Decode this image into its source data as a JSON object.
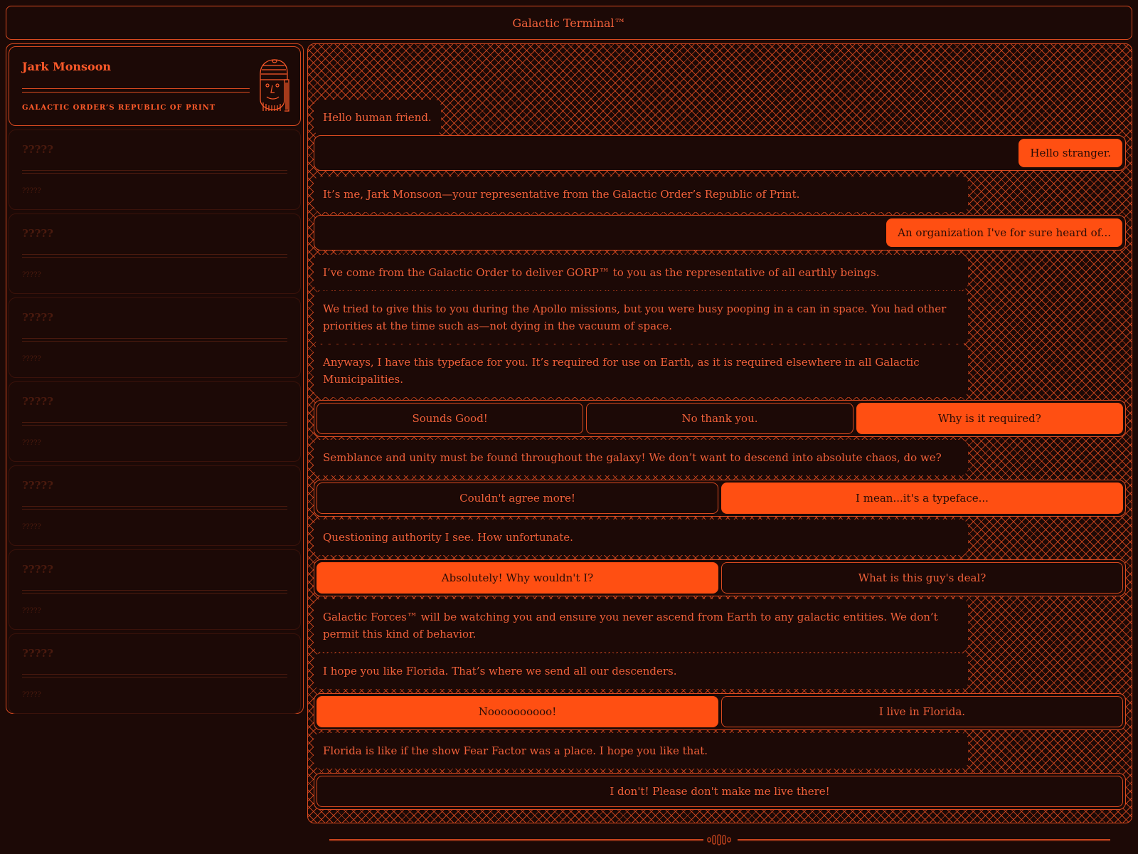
{
  "window": {
    "title": "Galactic Terminal™"
  },
  "profile": {
    "name": "Jark Monsoon",
    "org": "GALACTIC ORDER’S REPUBLIC OF PRINT",
    "avatar_icon": "helmeted-alien-portrait"
  },
  "contacts": [
    {
      "name": "?????",
      "sub": "?????"
    },
    {
      "name": "?????",
      "sub": "?????"
    },
    {
      "name": "?????",
      "sub": "?????"
    },
    {
      "name": "?????",
      "sub": "?????"
    },
    {
      "name": "?????",
      "sub": "?????"
    },
    {
      "name": "?????",
      "sub": "?????"
    },
    {
      "name": "?????",
      "sub": "?????"
    }
  ],
  "conversation": {
    "m1": "Hello human friend.",
    "r1": "Hello stranger.",
    "m2": "It’s me, Jark Monsoon—your representative from the Galactic Order’s Republic of Print.",
    "r2": "An organization I've for sure heard of...",
    "m3": "I’ve come from the Galactic Order to deliver GORP™ to you as the representative of all earthly beings.",
    "m4": "We tried to give this to you during the Apollo missions, but you were busy pooping in a can in space. You had other priorities at the time such as—not dying in the vacuum of space.",
    "m5": "Anyways, I have this typeface for you. It’s required for use on Earth, as it is required elsewhere in all Galactic Municipalities.",
    "c1": [
      "Sounds Good!",
      "No thank you.",
      "Why is it required?"
    ],
    "m6": "Semblance and unity must be found throughout the galaxy! We don’t want to descend into absolute chaos, do we?",
    "c2": [
      "Couldn't agree more!",
      "I mean...it's a typeface..."
    ],
    "m7": "Questioning authority I see. How unfortunate.",
    "c3": [
      "Absolutely! Why wouldn't I?",
      "What is this guy's deal?"
    ],
    "m8": "Galactic Forces™ will be watching you and ensure you never ascend from Earth to any galactic entities. We don’t permit this kind of behavior.",
    "m9": "I hope you like Florida. That’s where we send all our descenders.",
    "c4": [
      "Noooooooooo!",
      "I live in Florida."
    ],
    "m10": "Florida is like if the show Fear Factor was a place. I hope you like that.",
    "c5": [
      "I don't! Please don't make me live there!"
    ]
  },
  "colors": {
    "accent": "#ff4f12",
    "background": "#1c0906",
    "line": "#d94a20"
  }
}
